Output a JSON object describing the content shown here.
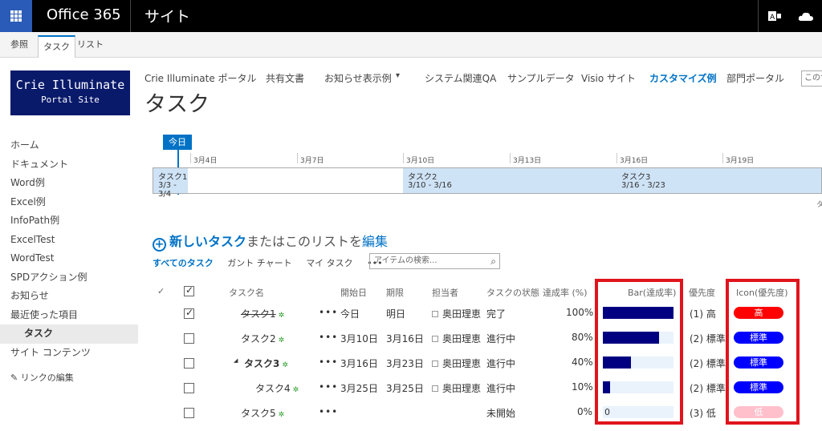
{
  "suite": {
    "brand": "Office 365",
    "site_title": "サイト"
  },
  "ribbon": {
    "tabs": [
      "参照",
      "タスク",
      "リスト"
    ]
  },
  "logo": {
    "line1": "Crie Illuminate",
    "line2": "Portal Site"
  },
  "topnav": {
    "items": [
      "Crie Illuminate ポータル",
      "共有文書",
      "お知らせ表示例",
      "システム関連QA",
      "サンプルデータ",
      "Visio サイト",
      "カスタマイズ例",
      "部門ポータル"
    ],
    "dropdown_arrow": "▾",
    "search_placeholder": "このサ"
  },
  "page_title": "タスク",
  "leftnav": {
    "items": [
      "ホーム",
      "ドキュメント",
      "Word例",
      "Excel例",
      "InfoPath例",
      "ExcelTest",
      "WordTest",
      "SPDアクション例",
      "お知らせ",
      "最近使った項目"
    ],
    "sub_item": "タスク",
    "site_contents": "サイト コンテンツ",
    "edit_links": "リンクの編集"
  },
  "timeline": {
    "today": "今日",
    "dates": [
      "3月4日",
      "3月7日",
      "3月10日",
      "3月13日",
      "3月16日",
      "3月19日"
    ],
    "bars": [
      {
        "name": "タスク1",
        "range": "3/3 - 3/4"
      },
      {
        "name": "タスク2",
        "range": "3/10 - 3/16"
      },
      {
        "name": "タスク3",
        "range": "3/16 - 3/23"
      }
    ],
    "overflow_text": "タ"
  },
  "newtask": {
    "prefix": "新しいタスク",
    "middle": "またはこのリストを",
    "edit": "編集"
  },
  "views": {
    "items": [
      "すべてのタスク",
      "ガント チャート",
      "マイ タスク"
    ],
    "more": "•••",
    "search_placeholder": "アイテムの検索..."
  },
  "table": {
    "headers": {
      "check": "✓",
      "name": "タスク名",
      "start": "開始日",
      "due": "期限",
      "assignee": "担当者",
      "status": "タスクの状態",
      "percent": "達成率 (%)",
      "bar": "Bar(達成率)",
      "priority": "優先度",
      "icon": "Icon(優先度)"
    },
    "ellipsis": "•••",
    "star": "✲",
    "expander": "◢",
    "rows": [
      {
        "name": "タスク1",
        "start": "今日",
        "due": "明日",
        "assignee": "奥田理恵",
        "status": "完了",
        "percent": "100%",
        "pct": 1.0,
        "priority": "(1) 高",
        "icon": "高",
        "color": "#ff0000",
        "checked": true
      },
      {
        "name": "タスク2",
        "start": "3月10日",
        "due": "3月16日",
        "assignee": "奥田理恵",
        "status": "進行中",
        "percent": "80%",
        "pct": 0.8,
        "priority": "(2) 標準",
        "icon": "標準",
        "color": "#0000ff",
        "checked": false
      },
      {
        "name": "タスク3",
        "start": "3月16日",
        "due": "3月23日",
        "assignee": "奥田理恵",
        "status": "進行中",
        "percent": "40%",
        "pct": 0.4,
        "priority": "(2) 標準",
        "icon": "標準",
        "color": "#0000ff",
        "checked": false
      },
      {
        "name": "タスク4",
        "start": "3月25日",
        "due": "3月25日",
        "assignee": "奥田理恵",
        "status": "進行中",
        "percent": "10%",
        "pct": 0.1,
        "priority": "(2) 標準",
        "icon": "標準",
        "color": "#0000ff",
        "checked": false
      },
      {
        "name": "タスク5",
        "start": "",
        "due": "",
        "assignee": "",
        "status": "未開始",
        "percent": "0%",
        "pct": 0.0,
        "bar_label": "0",
        "priority": "(3) 低",
        "icon": "低",
        "color": "#ffc0cb",
        "checked": false
      }
    ]
  },
  "colors": {
    "accent": "#0072c6",
    "bar_fill": "#000080",
    "bar_bg": "#eaf3fc",
    "highlight_box": "#e0141c"
  }
}
